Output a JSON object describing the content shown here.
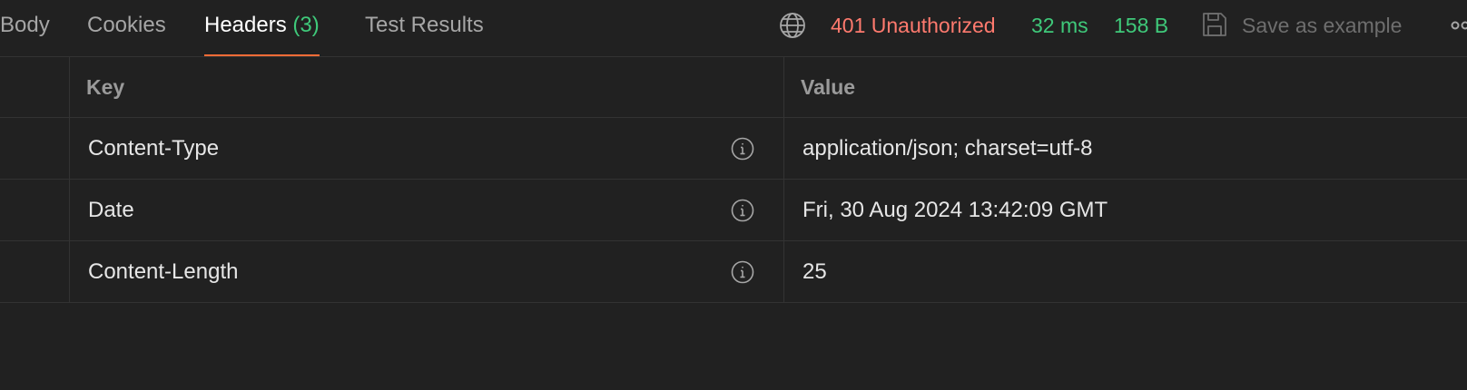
{
  "tabs": [
    {
      "label": "Body",
      "count": ""
    },
    {
      "label": "Cookies",
      "count": ""
    },
    {
      "label": "Headers",
      "count": "(3)"
    },
    {
      "label": "Test Results",
      "count": ""
    }
  ],
  "response": {
    "status": "401 Unauthorized",
    "time": "32 ms",
    "size": "158 B",
    "save_label": "Save as example"
  },
  "table": {
    "columns": [
      "Key",
      "Value"
    ],
    "rows": [
      {
        "key": "Content-Type",
        "value": "application/json; charset=utf-8"
      },
      {
        "key": "Date",
        "value": "Fri, 30 Aug 2024 13:42:09 GMT"
      },
      {
        "key": "Content-Length",
        "value": "25"
      }
    ]
  },
  "colors": {
    "accent": "#ff6c37",
    "error": "#ff7a6e",
    "success": "#3fc97a",
    "background": "#212121"
  },
  "icons": {
    "network": "globe-icon",
    "save": "save-icon",
    "info": "info-icon",
    "more": "more-icon"
  }
}
